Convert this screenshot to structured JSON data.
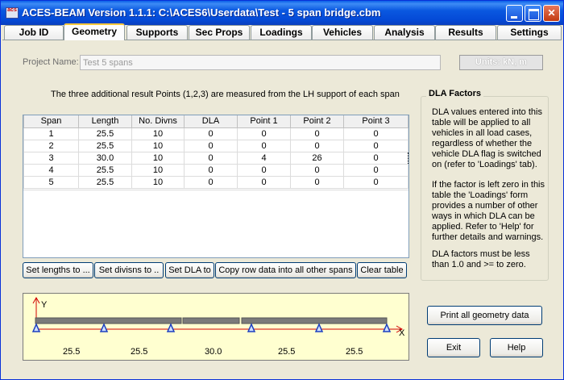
{
  "window": {
    "title": "ACES-BEAM Version 1.1.1:   C:\\ACES6\\Userdata\\Test - 5 span bridge.cbm",
    "icon_text": "acs"
  },
  "tabs": [
    {
      "label": "Job ID",
      "active": false
    },
    {
      "label": "Geometry",
      "active": true
    },
    {
      "label": "Supports",
      "active": false
    },
    {
      "label": "Sec Props",
      "active": false
    },
    {
      "label": "Loadings",
      "active": false
    },
    {
      "label": "Vehicles",
      "active": false
    },
    {
      "label": "Analysis",
      "active": false
    },
    {
      "label": "Results",
      "active": false
    },
    {
      "label": "Settings",
      "active": false
    }
  ],
  "project": {
    "label": "Project Name:",
    "value": "Test 5 spans",
    "units": "Units: kN, m"
  },
  "info_line": "The three additional result Points (1,2,3) are measured from the LH support of each span",
  "table": {
    "headers": [
      "Span",
      "Length",
      "No. Divns",
      "DLA",
      "Point 1",
      "Point 2",
      "Point 3"
    ],
    "rows": [
      [
        "1",
        "25.5",
        "10",
        "0",
        "0",
        "0",
        "0"
      ],
      [
        "2",
        "25.5",
        "10",
        "0",
        "0",
        "0",
        "0"
      ],
      [
        "3",
        "30.0",
        "10",
        "0",
        "4",
        "26",
        "0"
      ],
      [
        "4",
        "25.5",
        "10",
        "0",
        "0",
        "0",
        "0"
      ],
      [
        "5",
        "25.5",
        "10",
        "0",
        "0",
        "0",
        "0"
      ]
    ]
  },
  "table_buttons": {
    "set_lengths": "Set lengths to ...",
    "set_divisions": "Set divisns to ..",
    "set_dla": "Set DLA to",
    "copy_row": "Copy row data into all other spans",
    "clear_table": "Clear table"
  },
  "dla_panel": {
    "title": "DLA Factors",
    "para1": "DLA values entered into this table will be applied to all vehicles in all load cases, regardless of whether the vehicle DLA flag is switched on (refer to 'Loadings' tab).",
    "para2": "If the factor is left zero in this table the 'Loadings' form provides a number of other ways in which DLA can be applied.  Refer to 'Help' for further details and warnings.",
    "para3": "DLA factors must be less than 1.0 and >= to zero."
  },
  "diagram": {
    "y_label": "Y",
    "x_label": "X",
    "span_lengths": [
      "25.5",
      "25.5",
      "30.0",
      "25.5",
      "25.5"
    ]
  },
  "buttons": {
    "print_geometry": "Print all geometry data",
    "exit": "Exit",
    "help": "Help"
  }
}
